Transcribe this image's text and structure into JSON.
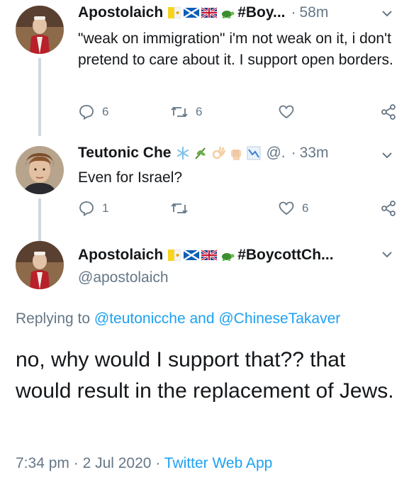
{
  "tweets": [
    {
      "name": "Apostolaich",
      "hashtag": "#Boy...",
      "dot": "·",
      "time": "58m",
      "text": "\"weak on immigration\" i'm not weak on it, i don't pretend to care about it. I support open borders.",
      "reply_count": "6",
      "retweet_count": "6",
      "like_count": ""
    },
    {
      "name": "Teutonic Che",
      "handle": "@.",
      "dot": "·",
      "time": "33m",
      "text": "Even for Israel?",
      "reply_count": "1",
      "retweet_count": "",
      "like_count": "6"
    }
  ],
  "focused": {
    "name": "Apostolaich",
    "hashtag": "#BoycottCh...",
    "handle": "@apostolaich",
    "replying_prefix": "Replying to ",
    "replying_user1": "@teutonicche",
    "replying_and": " and ",
    "replying_user2": "@ChineseTakaver",
    "text": "no, why would I support that?? that would result in the replacement of Jews.",
    "time": "7:34 pm",
    "sep1": " · ",
    "date": "2 Jul 2020",
    "sep2": " · ",
    "client": "Twitter Web App"
  },
  "icons": {
    "reply": "reply-icon",
    "retweet": "retweet-icon",
    "like": "heart-icon",
    "share": "share-icon",
    "caret": "chevron-down-icon"
  },
  "colors": {
    "text": "#14171a",
    "secondary": "#657786",
    "link": "#1da1f2",
    "thread_line": "#cfd9de"
  }
}
